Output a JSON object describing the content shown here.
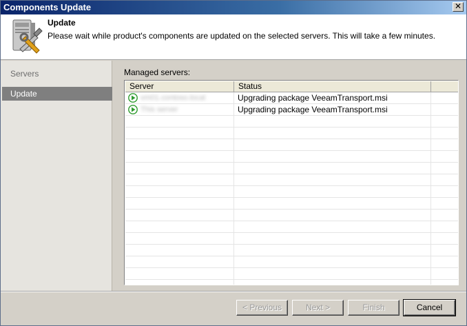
{
  "window": {
    "title": "Components Update",
    "close_glyph": "✕"
  },
  "header": {
    "title": "Update",
    "description": "Please wait while product's components are updated on the selected servers. This will take a few minutes.",
    "icon": "server-tools-icon"
  },
  "sidebar": {
    "items": [
      {
        "label": "Servers",
        "active": false
      },
      {
        "label": "Update",
        "active": true
      }
    ]
  },
  "main": {
    "grid_label": "Managed servers:",
    "columns": [
      "Server",
      "Status"
    ],
    "rows": [
      {
        "server": "vm01.contoso.local",
        "status": "Upgrading package VeeamTransport.msi",
        "icon": "play-green-icon"
      },
      {
        "server": "This server",
        "status": "Upgrading package VeeamTransport.msi",
        "icon": "play-green-icon"
      }
    ]
  },
  "footer": {
    "previous_label": "< Previous",
    "next_label": "Next >",
    "finish_label": "Finish",
    "cancel_label": "Cancel"
  },
  "colors": {
    "title_bar": "#0a246a",
    "active_nav": "#7f7f7f",
    "status_icon": "#2e9b2e"
  }
}
